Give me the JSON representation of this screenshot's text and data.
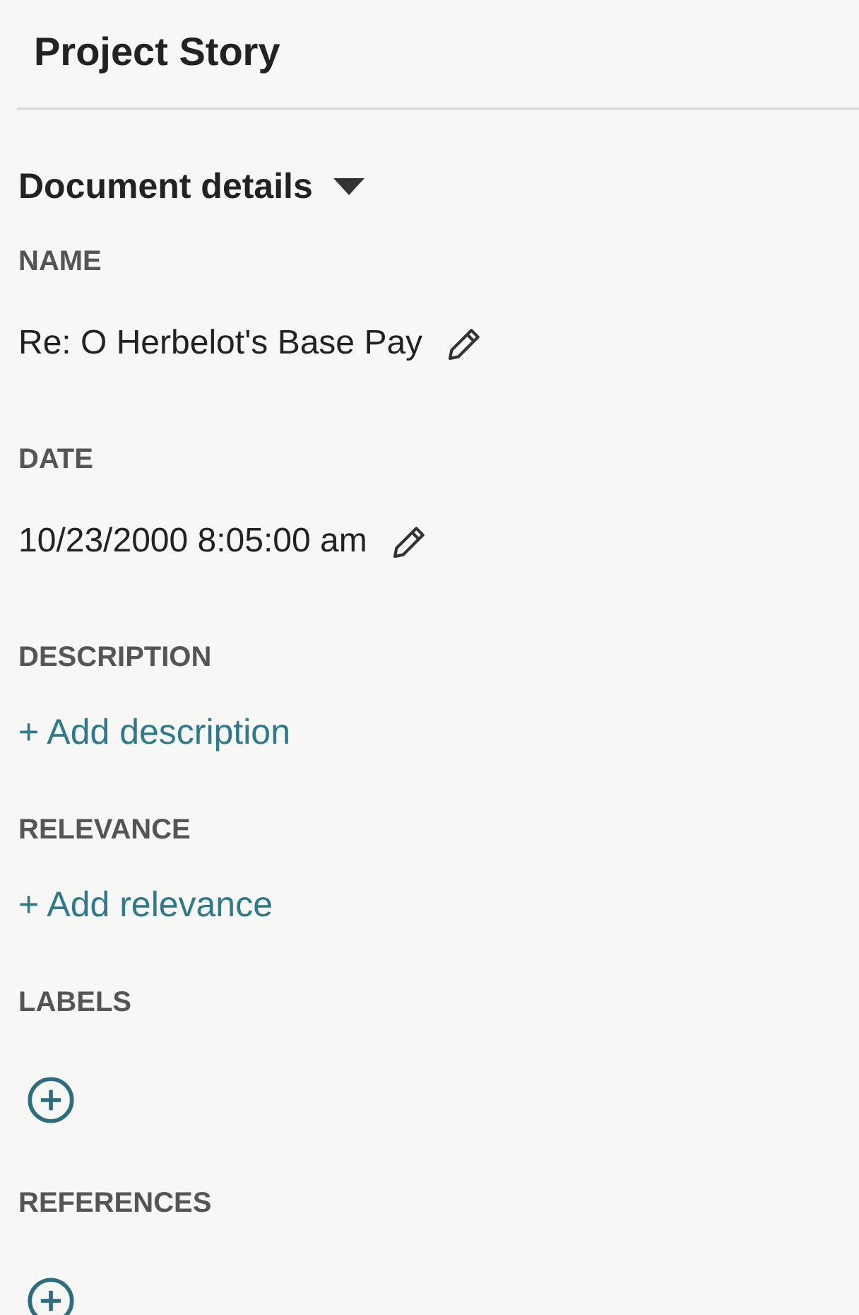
{
  "header": {
    "title": "Project Story"
  },
  "section": {
    "title": "Document details",
    "expanded": true
  },
  "fields": [
    {
      "label": "NAME",
      "kind": "text",
      "value": "Re: O Herbelot's Base Pay"
    },
    {
      "label": "DATE",
      "kind": "text",
      "value": "10/23/2000 8:05:00 am"
    },
    {
      "label": "DESCRIPTION",
      "kind": "link",
      "value": "+ Add description"
    },
    {
      "label": "RELEVANCE",
      "kind": "link",
      "value": "+ Add relevance"
    },
    {
      "label": "LABELS",
      "kind": "add"
    },
    {
      "label": "REFERENCES",
      "kind": "add"
    }
  ]
}
